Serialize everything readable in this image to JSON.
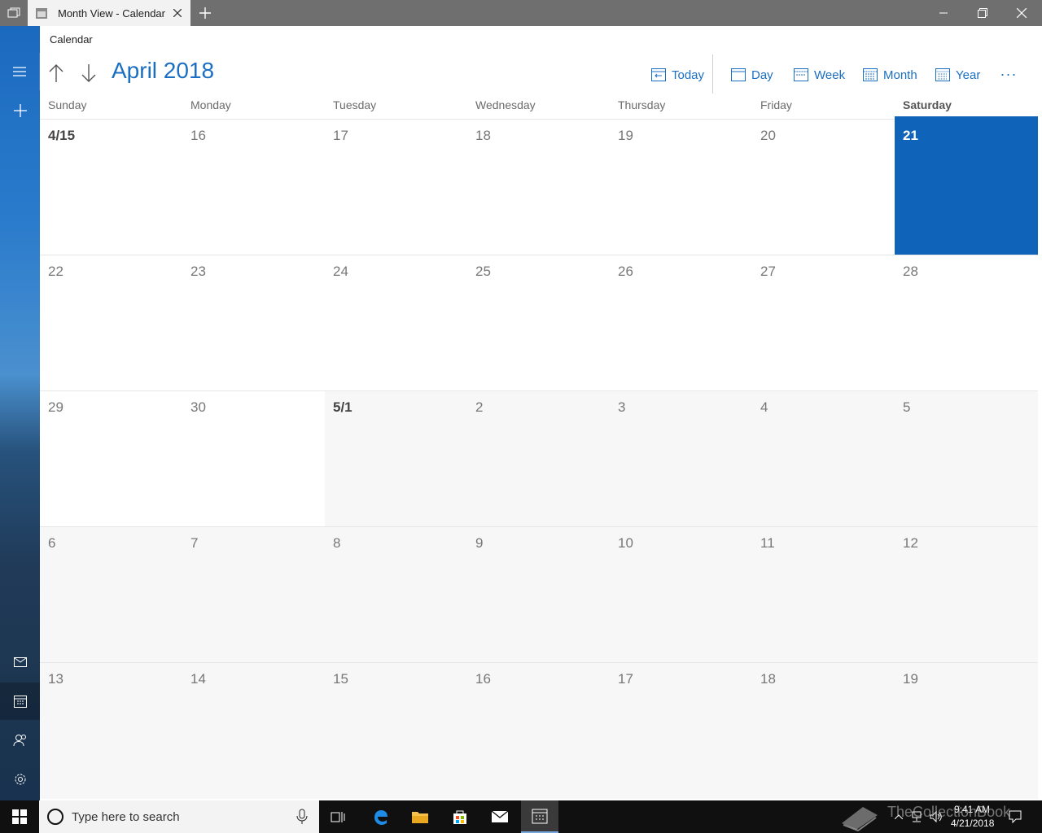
{
  "titlebar": {
    "tab_title": "Month View - Calendar"
  },
  "app": {
    "label": "Calendar",
    "month_title": "April 2018"
  },
  "commands": {
    "today": "Today",
    "day": "Day",
    "week": "Week",
    "month": "Month",
    "year": "Year",
    "more": "···"
  },
  "weekdays": [
    "Sunday",
    "Monday",
    "Tuesday",
    "Wednesday",
    "Thursday",
    "Friday",
    "Saturday"
  ],
  "weeks": [
    [
      "4/15",
      "16",
      "17",
      "18",
      "19",
      "20",
      "21"
    ],
    [
      "22",
      "23",
      "24",
      "25",
      "26",
      "27",
      "28"
    ],
    [
      "29",
      "30",
      "5/1",
      "2",
      "3",
      "4",
      "5"
    ],
    [
      "6",
      "7",
      "8",
      "9",
      "10",
      "11",
      "12"
    ],
    [
      "13",
      "14",
      "15",
      "16",
      "17",
      "18",
      "19"
    ]
  ],
  "today_cell": "21",
  "taskbar": {
    "search_placeholder": "Type here to search",
    "time": "9:41 AM",
    "date": "4/21/2018"
  },
  "watermark": "TheCollectionBook",
  "colors": {
    "accent": "#1b6fc2",
    "today_fill": "#0f63b8",
    "other_month_fill": "#f7f7f7"
  }
}
